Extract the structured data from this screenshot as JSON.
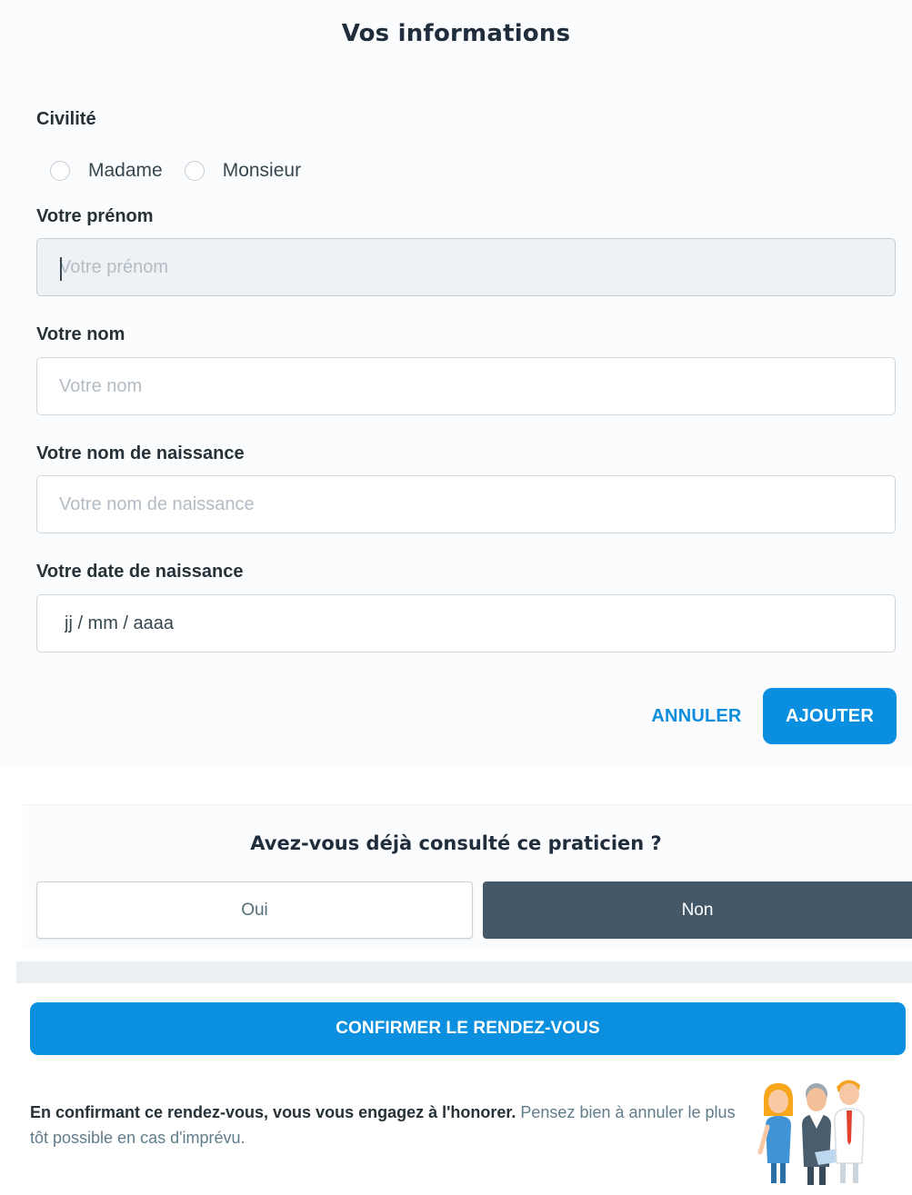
{
  "info_card": {
    "title": "Vos informations",
    "civility": {
      "label": "Civilité",
      "options": [
        "Madame",
        "Monsieur"
      ]
    },
    "first_name": {
      "label": "Votre prénom",
      "placeholder": "Votre prénom",
      "value": ""
    },
    "last_name": {
      "label": "Votre nom",
      "placeholder": "Votre nom",
      "value": ""
    },
    "birth_name": {
      "label": "Votre nom de naissance",
      "placeholder": "Votre nom de naissance",
      "value": ""
    },
    "birth_date": {
      "label": "Votre date de naissance",
      "placeholder": "jj / mm / aaaa",
      "value": ""
    },
    "cancel_label": "ANNULER",
    "add_label": "AJOUTER"
  },
  "question": {
    "title": "Avez-vous déjà consulté ce praticien ?",
    "yes_label": "Oui",
    "no_label": "Non",
    "selected": "Non"
  },
  "confirm": {
    "label": "CONFIRMER LE RENDEZ-VOUS"
  },
  "notice": {
    "bold": "En confirmant ce rendez-vous, vous vous engagez à l'honorer.",
    "regular": " Pensez bien à annuler le plus tôt possible en cas d'imprévu."
  },
  "colors": {
    "accent": "#0b8fdf",
    "dark_selected": "#445868",
    "text": "#263238"
  },
  "icons": {
    "illustration": "medical-staff-illustration"
  }
}
